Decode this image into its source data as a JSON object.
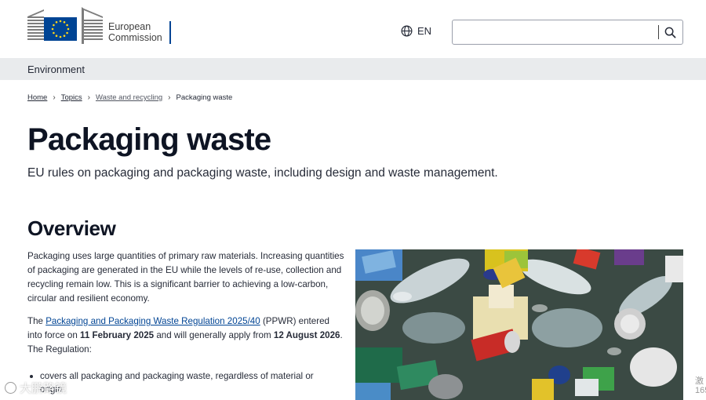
{
  "header": {
    "logo": {
      "line1": "European",
      "line2": "Commission",
      "alt": "European Commission logo"
    },
    "language": {
      "code": "EN",
      "icon": "globe-icon"
    },
    "search": {
      "value": "",
      "placeholder": "",
      "icon": "search-icon"
    }
  },
  "site_name": "Environment",
  "breadcrumb": {
    "items": [
      "Home",
      "Topics",
      "Waste and recycling",
      "Packaging waste"
    ]
  },
  "page": {
    "title": "Packaging waste",
    "subtitle": "EU rules on packaging and packaging waste, including design and waste management.",
    "section_title": "Overview",
    "p1": "Packaging uses large quantities of primary raw materials. Increasing quantities of packaging are generated in the EU while the levels of re-use, collection and recycling remain low.  This is a significant barrier to achieving a low-carbon, circular and resilient economy.",
    "p2": {
      "pre": "The ",
      "link": "Packaging and Packaging Waste Regulation 2025/40",
      "mid1": " (PPWR) entered into force on ",
      "date1": "11 February 2025",
      "mid2": " and will generally apply from ",
      "date2": "12 August 2026",
      "post": ". The Regulation:"
    },
    "list": [
      "covers all packaging and packaging waste, regardless of material or origin"
    ]
  },
  "image": {
    "alt": "Pile of mixed packaging waste: plastic bottles, cans, caps and containers"
  },
  "watermarks": {
    "left": "大鹏路镜",
    "right": "激\n165"
  },
  "colors": {
    "accent_blue": "#004494",
    "eu_yellow": "#ffd617",
    "text": "#262b38",
    "site_bar": "#e9ebed"
  }
}
